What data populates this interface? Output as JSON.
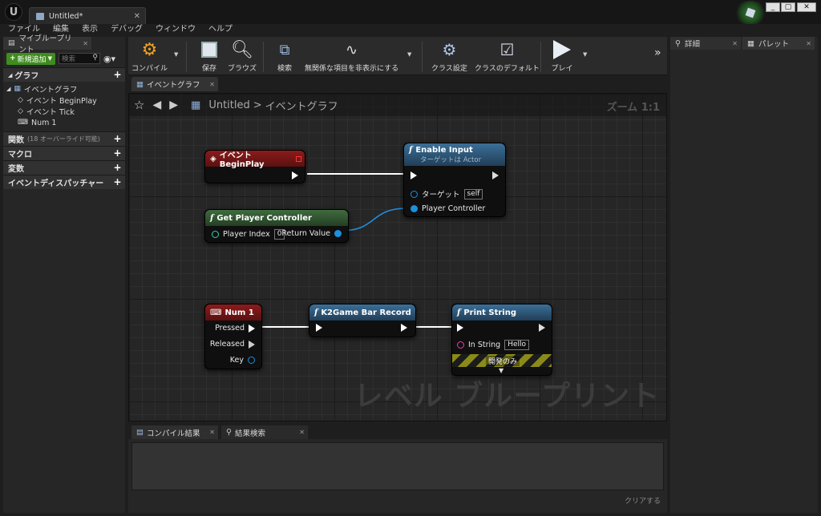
{
  "window": {
    "doc_tab": "Untitled*"
  },
  "menu": [
    "ファイル",
    "編集",
    "表示",
    "デバッグ",
    "ウィンドウ",
    "ヘルプ"
  ],
  "left": {
    "tab": "マイブループリント",
    "add_button": "新規追加",
    "search_placeholder": "検索",
    "sections": {
      "graph": "グラフ",
      "functions": "関数",
      "functions_note": "(18 オーバーライド可能)",
      "macros": "マクロ",
      "variables": "変数",
      "dispatchers": "イベントディスパッチャー"
    },
    "tree": {
      "root": "イベントグラフ",
      "items": [
        "イベント BeginPlay",
        "イベント Tick",
        "Num 1"
      ]
    }
  },
  "toolbar": {
    "compile": "コンパイル",
    "save": "保存",
    "browse": "ブラウズ",
    "search": "検索",
    "hide_unrelated": "無関係な項目を非表示にする",
    "class_settings": "クラス設定",
    "class_defaults": "クラスのデフォルト",
    "play": "プレイ"
  },
  "graph_tab": "イベントグラフ",
  "breadcrumb": {
    "root": "Untitled",
    "sep": ">",
    "current": "イベントグラフ"
  },
  "zoom": "ズーム 1:1",
  "watermark": "レベル ブループリント",
  "nodes": {
    "beginplay": {
      "title": "イベント BeginPlay"
    },
    "enable_input": {
      "title": "Enable Input",
      "subtitle": "ターゲットは Actor",
      "target": "ターゲット",
      "target_val": "self",
      "pc": "Player Controller"
    },
    "get_pc": {
      "title": "Get Player Controller",
      "index": "Player Index",
      "index_val": "0",
      "ret": "Return Value"
    },
    "num1": {
      "title": "Num 1",
      "pressed": "Pressed",
      "released": "Released",
      "key": "Key"
    },
    "k2": {
      "title": "K2Game Bar Record"
    },
    "print": {
      "title": "Print String",
      "in": "In String",
      "in_val": "Hello",
      "dev": "開発のみ"
    }
  },
  "bottom": {
    "tab1": "コンパイル結果",
    "tab2": "結果検索",
    "clear": "クリアする"
  },
  "right": {
    "tab1": "詳細",
    "tab2": "パレット"
  },
  "colors": {
    "event": "#8b1c1c",
    "pure": "#3f6b3f",
    "func": "#3b6f98",
    "link_blue": "#1d8fdc",
    "pin_pink": "#ea3ea9"
  }
}
